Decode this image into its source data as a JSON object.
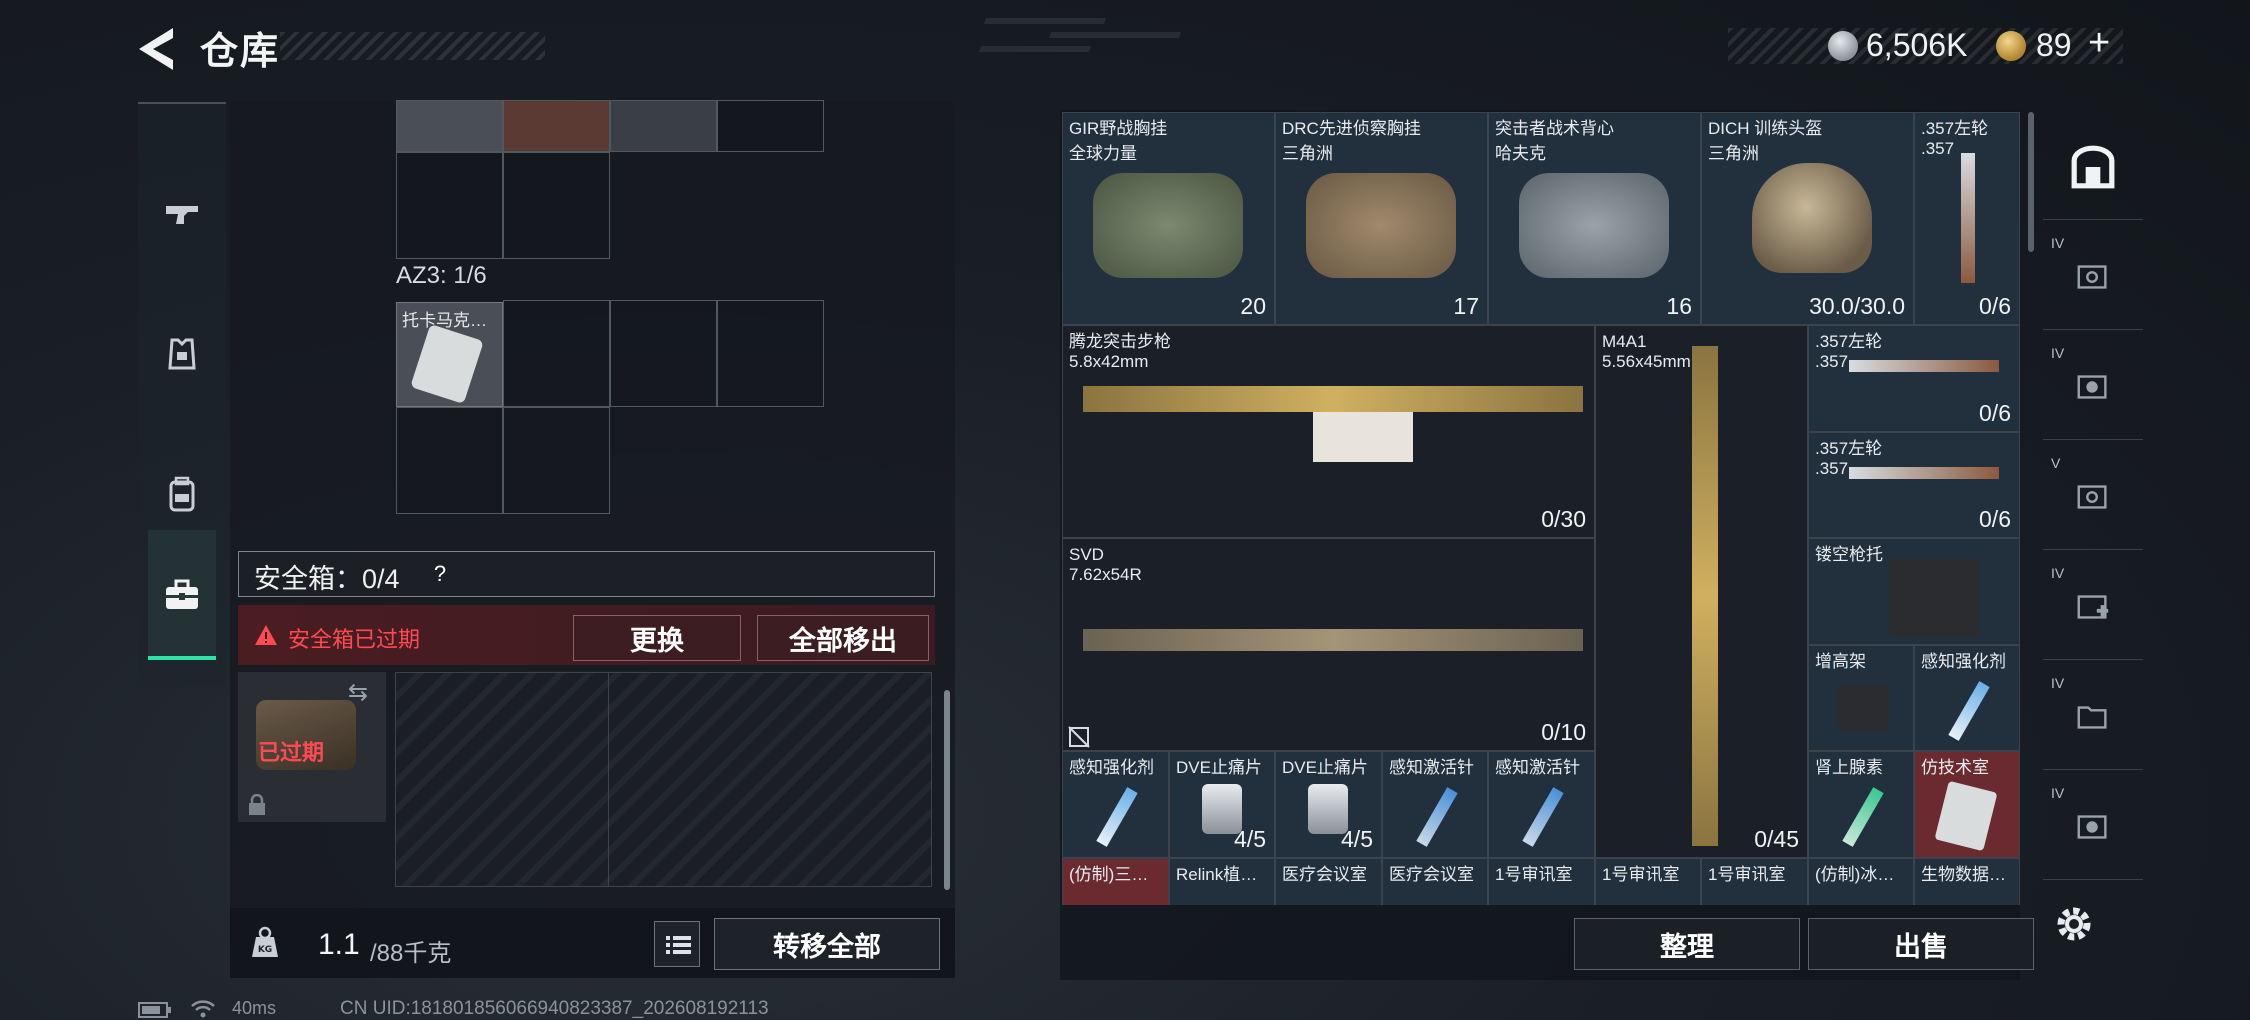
{
  "header": {
    "title": "仓库",
    "silver_value": "6,506K",
    "gold_value": "89",
    "gold_plus": "+"
  },
  "left_nav": {
    "items": [
      {
        "name": "weapons",
        "icon": "pistol-icon"
      },
      {
        "name": "armor",
        "icon": "armor-vest-icon"
      },
      {
        "name": "backpack",
        "icon": "backpack-icon"
      },
      {
        "name": "safebox",
        "icon": "toolbox-icon",
        "active": true
      }
    ]
  },
  "backpack": {
    "az3_label": "AZ3: 1/6",
    "az3_item_name": "托卡马克…"
  },
  "safebox": {
    "label": "安全箱：0/4",
    "help": "?",
    "expired_notice": "安全箱已过期",
    "swap_label": "更换",
    "remove_all_label": "全部移出",
    "case_expired_label": "已过期",
    "case_arrows": "⇆"
  },
  "footer_left": {
    "weight_value": "1.1",
    "weight_unit": "/88千克",
    "transfer_all_label": "转移全部"
  },
  "storage": {
    "items": [
      {
        "name": "GIR野战胸挂",
        "sub": "全球力量",
        "count": "20",
        "count_icon": "vest-icon"
      },
      {
        "name": "DRC先进侦察胸挂",
        "sub": "三角洲",
        "count": "17",
        "count_icon": "vest-icon"
      },
      {
        "name": "突击者战术背心",
        "sub": "哈夫克",
        "count": "16",
        "count_icon": "vest-icon"
      },
      {
        "name": "DICH 训练头盔",
        "sub": "三角洲",
        "count": "30.0/30.0"
      },
      {
        "name": ".357左轮",
        "sub": ".357",
        "count": "0/6"
      },
      {
        "name": "腾龙突击步枪",
        "sub": "5.8x42mm",
        "count": "0/30"
      },
      {
        "name": "M4A1",
        "sub": "5.56x45mm",
        "count": "0/45"
      },
      {
        "name": ".357左轮",
        "sub": ".357",
        "count": "0/6"
      },
      {
        "name": ".357左轮",
        "sub": ".357",
        "count": "0/6"
      },
      {
        "name": "SVD",
        "sub": "7.62x54R",
        "count": "0/10"
      },
      {
        "name": "镂空枪托",
        "sub": ""
      },
      {
        "name": "增高架",
        "sub": ""
      },
      {
        "name": "感知强化剂",
        "sub": ""
      },
      {
        "name": "感知强化剂",
        "sub": ""
      },
      {
        "name": "DVE止痛片",
        "sub": "",
        "count": "4/5"
      },
      {
        "name": "DVE止痛片",
        "sub": "",
        "count": "4/5"
      },
      {
        "name": "感知激活针",
        "sub": ""
      },
      {
        "name": "感知激活针",
        "sub": ""
      },
      {
        "name": "肾上腺素",
        "sub": ""
      },
      {
        "name": "仿技术室",
        "sub": ""
      },
      {
        "name": "(仿制)三…",
        "sub": ""
      },
      {
        "name": "Relink植…",
        "sub": ""
      },
      {
        "name": "医疗会议室",
        "sub": ""
      },
      {
        "name": "医疗会议室",
        "sub": ""
      },
      {
        "name": "1号审讯室",
        "sub": ""
      },
      {
        "name": "1号审讯室",
        "sub": ""
      },
      {
        "name": "1号审讯室",
        "sub": ""
      },
      {
        "name": "(仿制)冰…",
        "sub": ""
      },
      {
        "name": "生物数据…",
        "sub": ""
      }
    ],
    "sort_label": "整理",
    "sell_label": "出售"
  },
  "right_nav": {
    "levels": [
      "IV",
      "IV",
      "V",
      "IV",
      "IV",
      "IV"
    ]
  },
  "status": {
    "ping": "40ms",
    "uid": "CN UID:18180185606694082338​7_202608192113"
  },
  "colors": {
    "accent_green": "#2de3a4",
    "expired_red": "#ff4a52",
    "slot_blue": "#22303e",
    "slot_red": "#6a2a30"
  }
}
